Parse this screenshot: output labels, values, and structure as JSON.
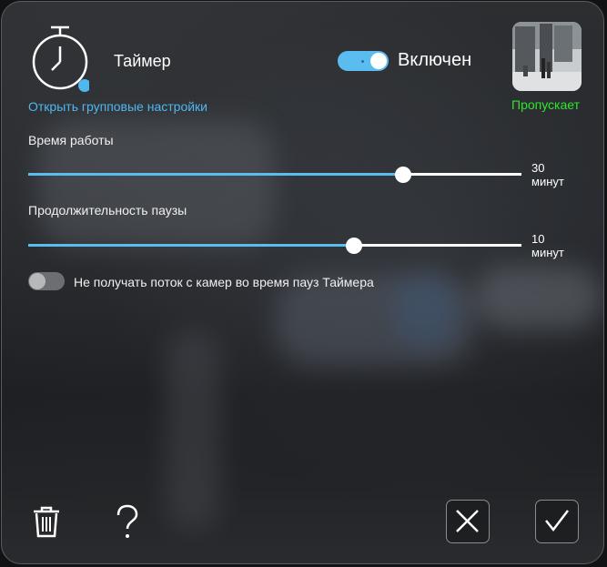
{
  "header": {
    "title": "Таймер",
    "group_settings_link": "Открыть групповые настройки",
    "toggle_label": "Включен",
    "toggle_state": "on",
    "camera_status": "Пропускает"
  },
  "sliders": [
    {
      "label": "Время работы",
      "value": "30",
      "unit": "минут",
      "level": 0.76
    },
    {
      "label": "Продолжительность паузы",
      "value": "10",
      "unit": "минут",
      "level": 0.66
    }
  ],
  "option": {
    "label": "Не получать поток с камер во время пауз Таймера",
    "state": "off"
  },
  "icons": {
    "timer": "stopwatch-icon",
    "delete": "trash-icon",
    "help": "question-mark-icon",
    "cancel": "close-icon",
    "confirm": "checkmark-icon"
  },
  "colors": {
    "accent": "#5bbcf0",
    "link": "#4fb7f0",
    "status_ok": "#2ee62e"
  }
}
